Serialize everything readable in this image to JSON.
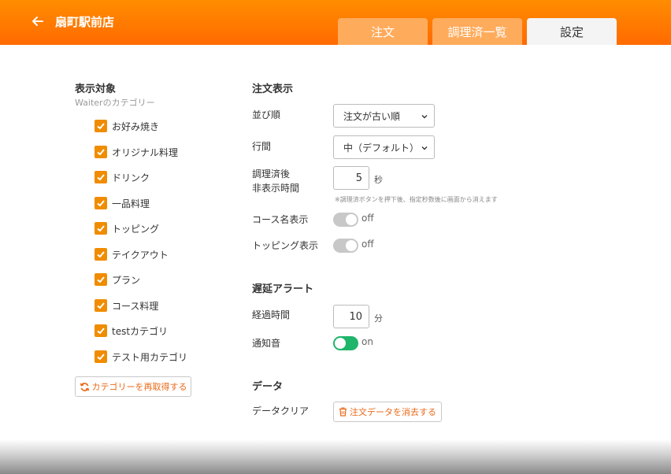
{
  "header": {
    "store_name": "扇町駅前店",
    "tabs": [
      {
        "label": "注文",
        "active": false
      },
      {
        "label": "調理済一覧",
        "active": false
      },
      {
        "label": "設定",
        "active": true
      }
    ],
    "color": "#ff7a00"
  },
  "categories_panel": {
    "title": "表示対象",
    "subtitle": "Waiterのカテゴリー",
    "items": [
      {
        "label": "お好み焼き",
        "checked": true
      },
      {
        "label": "オリジナル料理",
        "checked": true
      },
      {
        "label": "ドリンク",
        "checked": true
      },
      {
        "label": "一品料理",
        "checked": true
      },
      {
        "label": "トッピング",
        "checked": true
      },
      {
        "label": "テイクアウト",
        "checked": true
      },
      {
        "label": "プラン",
        "checked": true
      },
      {
        "label": "コース料理",
        "checked": true
      },
      {
        "label": "testカテゴリ",
        "checked": true
      },
      {
        "label": "テスト用カテゴリ",
        "checked": true
      }
    ],
    "refetch_button": "カテゴリーを再取得する",
    "checkbox_color": "#f08c00"
  },
  "order_display": {
    "title": "注文表示",
    "sort_label": "並び順",
    "sort_value": "注文が古い順",
    "spacing_label": "行間",
    "spacing_value": "中（デフォルト）",
    "hide_after_label_1": "調理済後",
    "hide_after_label_2": "非表示時間",
    "hide_after_value": "5",
    "hide_after_unit": "秒",
    "hide_after_note": "※調理済ボタンを押下後、指定秒数後に画面から消えます",
    "course_name_label": "コース名表示",
    "course_name_state": "off",
    "topping_label": "トッピング表示",
    "topping_state": "off"
  },
  "delay_alert": {
    "title": "遅延アラート",
    "elapsed_label": "経過時間",
    "elapsed_value": "10",
    "elapsed_unit": "分",
    "notify_label": "通知音",
    "notify_state": "on",
    "on_color": "#1fb56a"
  },
  "data_section": {
    "title": "データ",
    "clear_label": "データクリア",
    "clear_button": "注文データを消去する"
  }
}
